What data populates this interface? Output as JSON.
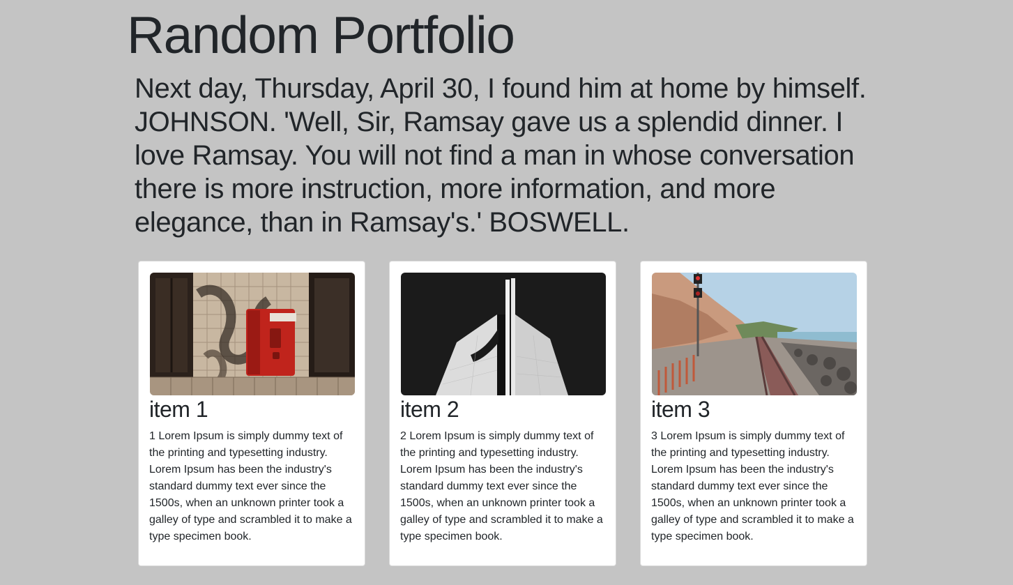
{
  "page": {
    "title": "Random Portfolio",
    "lead": "Next day, Thursday, April 30, I found him at home by himself. JOHNSON. 'Well, Sir, Ramsay gave us a splendid dinner. I love Ramsay. You will not find a man in whose conversation there is more instruction, more information, and more elegance, than in Ramsay's.' BOSWELL."
  },
  "colors": {
    "background": "#c4c4c4",
    "card": "#ffffff",
    "text": "#212529"
  },
  "cards": [
    {
      "image_icon": "fire-alarm-photo",
      "title": "item 1",
      "text": "1 Lorem Ipsum is simply dummy text of the printing and typesetting industry. Lorem Ipsum has been the industry's standard dummy text ever since the 1500s, when an unknown printer took a galley of type and scrambled it to make a type specimen book."
    },
    {
      "image_icon": "architecture-photo",
      "title": "item 2",
      "text": "2 Lorem Ipsum is simply dummy text of the printing and typesetting industry. Lorem Ipsum has been the industry's standard dummy text ever since the 1500s, when an unknown printer took a galley of type and scrambled it to make a type specimen book."
    },
    {
      "image_icon": "railway-coast-photo",
      "title": "item 3",
      "text": "3 Lorem Ipsum is simply dummy text of the printing and typesetting industry. Lorem Ipsum has been the industry's standard dummy text ever since the 1500s, when an unknown printer took a galley of type and scrambled it to make a type specimen book."
    }
  ]
}
